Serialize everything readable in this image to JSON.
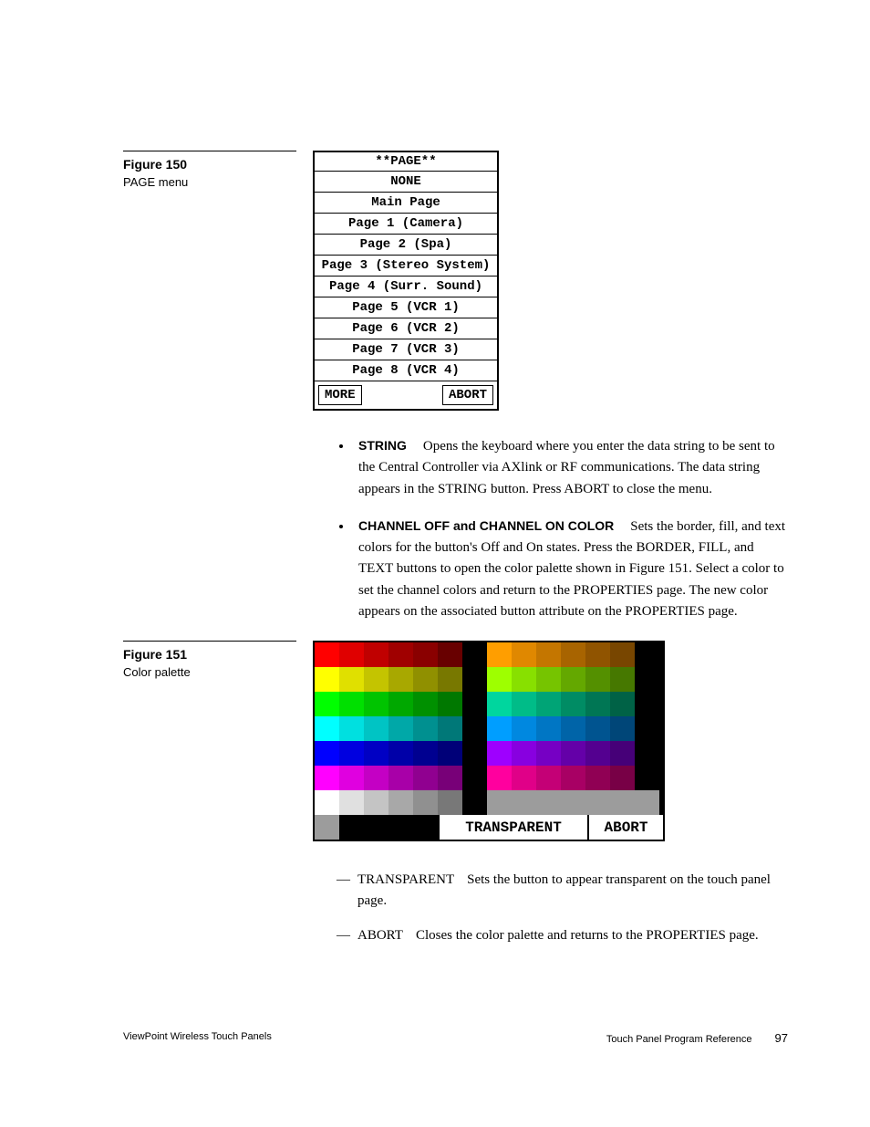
{
  "figure150": {
    "label": "Figure 150",
    "caption": "PAGE menu",
    "menu": {
      "title": "**PAGE**",
      "items": [
        "NONE",
        "Main Page",
        "Page 1 (Camera)",
        "Page 2 (Spa)",
        "Page 3 (Stereo System)",
        "Page 4 (Surr. Sound)",
        "Page 5 (VCR 1)",
        "Page 6 (VCR 2)",
        "Page 7 (VCR 3)",
        "Page 8 (VCR 4)"
      ],
      "more": "MORE",
      "abort": "ABORT"
    }
  },
  "bullets": [
    {
      "term": "STRING",
      "text": "Opens the keyboard where you enter the data string to be sent to the Central Controller via AXlink or RF communications. The data string appears in the STRING button. Press ABORT to close the menu."
    },
    {
      "term": "CHANNEL OFF and CHANNEL ON COLOR",
      "text": "Sets the border, fill, and text colors for the button's Off and On states. Press the BORDER, FILL, and TEXT buttons to open the color palette shown in Figure 151. Select a color to set the channel colors and return to the PROPERTIES page. The new color appears on the associated button attribute on the PROPERTIES page."
    }
  ],
  "figure151": {
    "label": "Figure 151",
    "caption": "Color palette",
    "rows": [
      [
        "#ff0000",
        "#e00000",
        "#c00000",
        "#a00000",
        "#8a0000",
        "#680000",
        "#000000",
        "#ff9e00",
        "#e08800",
        "#c47600",
        "#a86400",
        "#905400",
        "#784600",
        "#000000"
      ],
      [
        "#ffff00",
        "#e0e000",
        "#c4c400",
        "#a8a800",
        "#909000",
        "#787800",
        "#000000",
        "#9eff00",
        "#88e000",
        "#76c400",
        "#64a800",
        "#549000",
        "#467800",
        "#000000"
      ],
      [
        "#00ff00",
        "#00e000",
        "#00c400",
        "#00a800",
        "#009000",
        "#007800",
        "#000000",
        "#00d69e",
        "#00bc88",
        "#00a476",
        "#008c64",
        "#007654",
        "#006246",
        "#000000"
      ],
      [
        "#00ffff",
        "#00e0e0",
        "#00c4c4",
        "#00a8a8",
        "#009090",
        "#007878",
        "#000000",
        "#009eff",
        "#0088e0",
        "#0076c4",
        "#0064a8",
        "#005490",
        "#004678",
        "#000000"
      ],
      [
        "#0000ff",
        "#0000e0",
        "#0000c4",
        "#0000a8",
        "#000090",
        "#000078",
        "#000000",
        "#9e00ff",
        "#8800e0",
        "#7600c4",
        "#6400a8",
        "#540090",
        "#460078",
        "#000000"
      ],
      [
        "#ff00ff",
        "#e000e0",
        "#c400c4",
        "#a800a8",
        "#900090",
        "#780078",
        "#000000",
        "#ff009e",
        "#e00088",
        "#c40076",
        "#a80064",
        "#900054",
        "#780046",
        "#000000"
      ],
      [
        "#ffffff",
        "#e0e0e0",
        "#c4c4c4",
        "#a8a8a8",
        "#909090",
        "#787878",
        "#000000",
        "#9c9c9c",
        "#9c9c9c",
        "#9c9c9c",
        "#9c9c9c",
        "#9c9c9c",
        "#9c9c9c",
        "#9c9c9c"
      ]
    ],
    "transparent": "TRANSPARENT",
    "abort": "ABORT"
  },
  "dashes": [
    {
      "term": "TRANSPARENT",
      "text": "Sets the button to appear transparent on the touch panel page."
    },
    {
      "term": "ABORT",
      "text": "Closes the color palette and returns to the PROPERTIES page."
    }
  ],
  "footer": {
    "left": "ViewPoint Wireless Touch Panels",
    "right": "Touch Panel Program Reference",
    "page": "97"
  }
}
